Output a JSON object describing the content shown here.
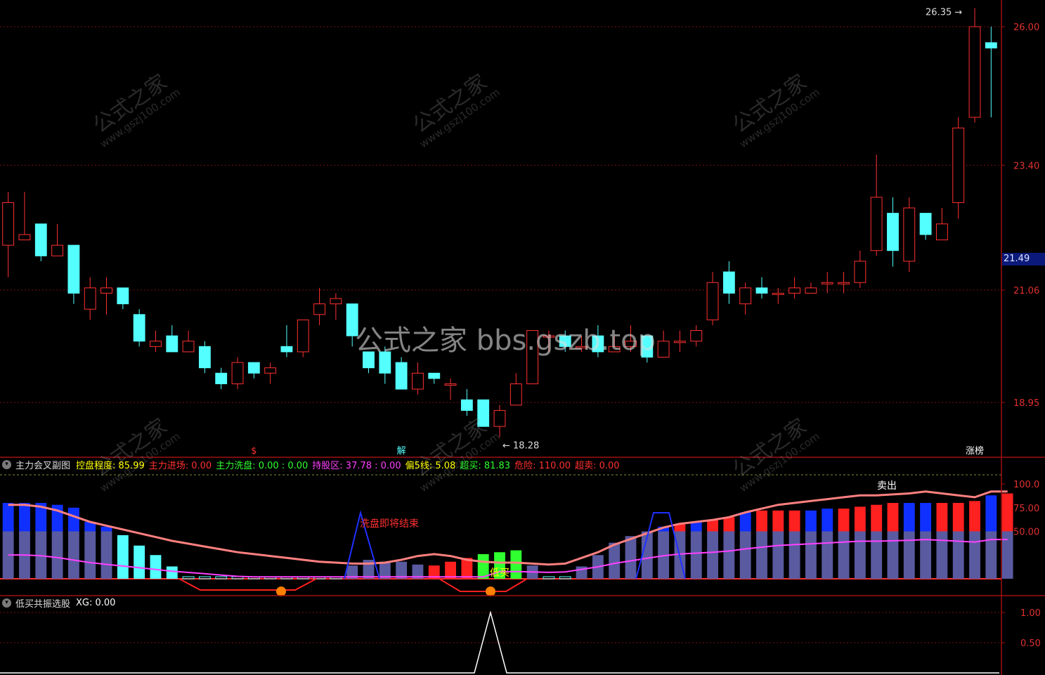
{
  "theme": {
    "up_color": "#ff3030",
    "down_color": "#54ffff",
    "grid_color": "#7a1010",
    "axis_color": "#a01010"
  },
  "top_labels": {
    "bars_visible": "partial header row cut off at top"
  },
  "main_chart": {
    "type": "candlestick",
    "price_axis": [
      "26.00",
      "23.40",
      "21.06",
      "18.95"
    ],
    "current_price": "21.49",
    "high_label": "26.35",
    "low_label": "18.28",
    "markers": [
      {
        "index": 15,
        "text": "$",
        "color": "#ff3030"
      },
      {
        "index": 24,
        "text": "解",
        "color": "#54ffff"
      },
      {
        "index": 59,
        "text": "涨榜",
        "color": "#ffffff"
      }
    ],
    "candles": [
      {
        "o": 21.9,
        "h": 22.9,
        "l": 21.3,
        "c": 22.7
      },
      {
        "o": 22.0,
        "h": 22.9,
        "l": 22.0,
        "c": 22.1
      },
      {
        "o": 22.3,
        "h": 22.3,
        "l": 21.6,
        "c": 21.7
      },
      {
        "o": 21.7,
        "h": 22.3,
        "l": 21.7,
        "c": 21.9
      },
      {
        "o": 21.9,
        "h": 21.9,
        "l": 20.8,
        "c": 21.0
      },
      {
        "o": 20.7,
        "h": 21.3,
        "l": 20.5,
        "c": 21.1
      },
      {
        "o": 21.0,
        "h": 21.3,
        "l": 20.6,
        "c": 21.1
      },
      {
        "o": 21.1,
        "h": 21.1,
        "l": 20.7,
        "c": 20.8
      },
      {
        "o": 20.6,
        "h": 20.7,
        "l": 20.0,
        "c": 20.1
      },
      {
        "o": 20.0,
        "h": 20.3,
        "l": 19.9,
        "c": 20.1
      },
      {
        "o": 20.2,
        "h": 20.4,
        "l": 19.9,
        "c": 19.9
      },
      {
        "o": 19.9,
        "h": 20.3,
        "l": 19.9,
        "c": 20.1
      },
      {
        "o": 20.0,
        "h": 20.1,
        "l": 19.5,
        "c": 19.6
      },
      {
        "o": 19.5,
        "h": 19.6,
        "l": 19.2,
        "c": 19.3
      },
      {
        "o": 19.3,
        "h": 19.8,
        "l": 19.2,
        "c": 19.7
      },
      {
        "o": 19.7,
        "h": 19.7,
        "l": 19.4,
        "c": 19.5
      },
      {
        "o": 19.5,
        "h": 19.7,
        "l": 19.3,
        "c": 19.6
      },
      {
        "o": 20.0,
        "h": 20.4,
        "l": 19.8,
        "c": 19.9
      },
      {
        "o": 19.9,
        "h": 20.5,
        "l": 19.8,
        "c": 20.5
      },
      {
        "o": 20.6,
        "h": 21.1,
        "l": 20.4,
        "c": 20.8
      },
      {
        "o": 20.8,
        "h": 21.0,
        "l": 20.5,
        "c": 20.9
      },
      {
        "o": 20.8,
        "h": 20.8,
        "l": 20.0,
        "c": 20.2
      },
      {
        "o": 19.9,
        "h": 19.9,
        "l": 19.5,
        "c": 19.6
      },
      {
        "o": 19.9,
        "h": 20.0,
        "l": 19.3,
        "c": 19.5
      },
      {
        "o": 19.7,
        "h": 19.8,
        "l": 19.2,
        "c": 19.2
      },
      {
        "o": 19.2,
        "h": 19.7,
        "l": 19.1,
        "c": 19.5
      },
      {
        "o": 19.5,
        "h": 19.5,
        "l": 19.3,
        "c": 19.4
      },
      {
        "o": 19.3,
        "h": 19.4,
        "l": 19.0,
        "c": 19.3
      },
      {
        "o": 19.0,
        "h": 19.2,
        "l": 18.7,
        "c": 18.8
      },
      {
        "o": 19.0,
        "h": 19.0,
        "l": 18.5,
        "c": 18.5
      },
      {
        "o": 18.5,
        "h": 18.9,
        "l": 18.3,
        "c": 18.8
      },
      {
        "o": 18.9,
        "h": 19.5,
        "l": 18.9,
        "c": 19.3
      },
      {
        "o": 19.3,
        "h": 19.5,
        "l": 19.3,
        "c": 20.3
      },
      {
        "o": 20.2,
        "h": 20.3,
        "l": 19.9,
        "c": 20.2
      },
      {
        "o": 20.2,
        "h": 20.3,
        "l": 19.9,
        "c": 20.0
      },
      {
        "o": 20.0,
        "h": 20.2,
        "l": 19.9,
        "c": 20.0
      },
      {
        "o": 20.2,
        "h": 20.4,
        "l": 19.8,
        "c": 19.9
      },
      {
        "o": 19.9,
        "h": 20.2,
        "l": 19.9,
        "c": 20.0
      },
      {
        "o": 20.0,
        "h": 20.4,
        "l": 19.9,
        "c": 20.1
      },
      {
        "o": 20.2,
        "h": 20.2,
        "l": 19.7,
        "c": 19.8
      },
      {
        "o": 19.8,
        "h": 20.3,
        "l": 19.8,
        "c": 20.1
      },
      {
        "o": 20.1,
        "h": 20.3,
        "l": 19.9,
        "c": 20.1
      },
      {
        "o": 20.1,
        "h": 20.4,
        "l": 20.0,
        "c": 20.3
      },
      {
        "o": 20.5,
        "h": 21.4,
        "l": 20.4,
        "c": 21.2
      },
      {
        "o": 21.4,
        "h": 21.6,
        "l": 20.8,
        "c": 21.0
      },
      {
        "o": 20.8,
        "h": 21.2,
        "l": 20.6,
        "c": 21.1
      },
      {
        "o": 21.1,
        "h": 21.3,
        "l": 20.9,
        "c": 21.0
      },
      {
        "o": 21.0,
        "h": 21.1,
        "l": 20.8,
        "c": 21.0
      },
      {
        "o": 21.0,
        "h": 21.3,
        "l": 20.9,
        "c": 21.1
      },
      {
        "o": 21.0,
        "h": 21.2,
        "l": 21.0,
        "c": 21.1
      },
      {
        "o": 21.2,
        "h": 21.4,
        "l": 21.0,
        "c": 21.2
      },
      {
        "o": 21.2,
        "h": 21.4,
        "l": 21.0,
        "c": 21.2
      },
      {
        "o": 21.2,
        "h": 21.8,
        "l": 21.1,
        "c": 21.6
      },
      {
        "o": 21.8,
        "h": 23.6,
        "l": 21.7,
        "c": 22.8
      },
      {
        "o": 22.5,
        "h": 22.8,
        "l": 21.5,
        "c": 21.8
      },
      {
        "o": 21.6,
        "h": 22.8,
        "l": 21.4,
        "c": 22.6
      },
      {
        "o": 22.5,
        "h": 22.5,
        "l": 22.0,
        "c": 22.1
      },
      {
        "o": 22.0,
        "h": 22.6,
        "l": 22.0,
        "c": 22.3
      },
      {
        "o": 22.7,
        "h": 24.3,
        "l": 22.4,
        "c": 24.1
      },
      {
        "o": 24.3,
        "h": 26.35,
        "l": 24.2,
        "c": 26.0
      },
      {
        "o": 25.7,
        "h": 26.0,
        "l": 24.3,
        "c": 25.6
      }
    ]
  },
  "sub1": {
    "title": "主力会叉副图",
    "items": [
      {
        "text": "控盘程度: 85.99",
        "color": "#ffff00"
      },
      {
        "text": "主力进场: 0.00",
        "color": "#ff3030"
      },
      {
        "text": "主力洗盘: 0.00 : 0.00",
        "color": "#30ff30"
      },
      {
        "text": "持股区: 37.78 : 0.00",
        "color": "#ff40ff"
      },
      {
        "text": "偏5线: 5.08",
        "color": "#ffff00"
      },
      {
        "text": "超买: 81.83",
        "color": "#30ff30"
      },
      {
        "text": "危险: 110.00",
        "color": "#ff3030"
      },
      {
        "text": "超卖: 0.00",
        "color": "#ff3030"
      }
    ],
    "axis": [
      "100.0",
      "75.00",
      "50.00"
    ],
    "annotations": [
      {
        "text": "洗盘即将结束",
        "color": "#ff3030"
      },
      {
        "text": "低买",
        "color": "#ffff00"
      },
      {
        "text": "卖出",
        "color": "#ffffff"
      }
    ],
    "bar_values": [
      80,
      80,
      80,
      78,
      75,
      60,
      55,
      46,
      35,
      25,
      13,
      0,
      0,
      0,
      0,
      0,
      0,
      0,
      0,
      0,
      0,
      14,
      20,
      18,
      18,
      15,
      14,
      18,
      22,
      26,
      28,
      30,
      14,
      0,
      0,
      13,
      25,
      38,
      45,
      50,
      55,
      58,
      60,
      62,
      65,
      70,
      72,
      72,
      72,
      72,
      74,
      74,
      76,
      78,
      80,
      80,
      80,
      80,
      80,
      82,
      88,
      90
    ],
    "line_values": [
      78,
      78,
      76,
      72,
      66,
      60,
      56,
      52,
      48,
      44,
      40,
      37,
      34,
      31,
      28,
      26,
      24,
      22,
      20,
      18,
      17,
      16,
      16,
      17,
      20,
      24,
      26,
      24,
      20,
      18,
      17,
      17,
      16,
      15,
      16,
      22,
      28,
      36,
      42,
      48,
      54,
      58,
      60,
      62,
      65,
      70,
      74,
      78,
      80,
      82,
      84,
      86,
      88,
      88,
      89,
      90,
      92,
      90,
      88,
      86,
      92,
      92
    ]
  },
  "sub2": {
    "title": "低买共振选股",
    "items": [
      {
        "text": "XG: 0.00",
        "color": "#ffffff"
      }
    ],
    "axis": [
      "1.00",
      "0.50"
    ]
  },
  "watermark": {
    "big": "公式之家 bbs.gszb.top",
    "small_cn": "公式之家",
    "small_url": "www.gszj100.com"
  }
}
